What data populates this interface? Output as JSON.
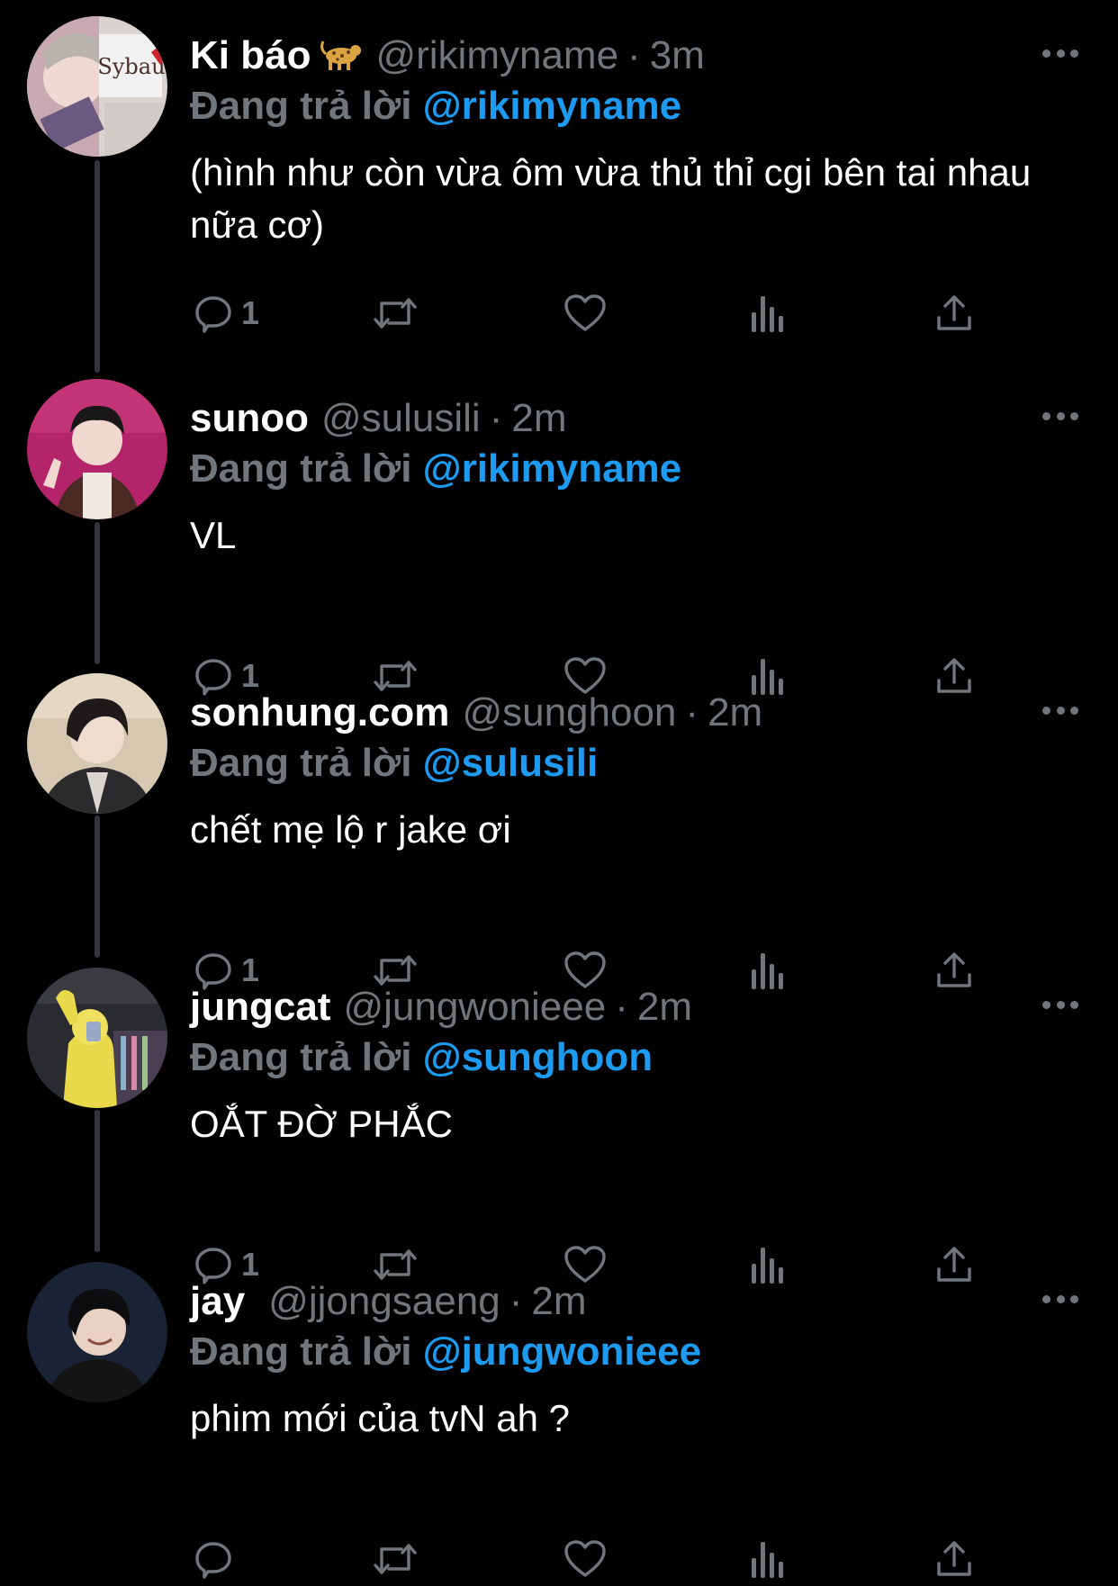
{
  "replying_prefix": "Đang trả lời",
  "colors": {
    "background": "#000000",
    "secondary_text": "#71767b",
    "mention": "#1d9bf0",
    "primary_text": "#ffffff"
  },
  "action_icons": [
    "reply-icon",
    "retweet-icon",
    "like-icon",
    "views-icon",
    "share-icon"
  ],
  "tweets": [
    {
      "name": "Ki báo",
      "name_emoji": "🐆",
      "handle": "@rikimyname",
      "dot": "·",
      "time": "3m",
      "reply_to": "@rikimyname",
      "text": "(hình như còn vừa ôm vừa thủ thỉ cgi bên tai nhau nữa cơ)",
      "reply_count": "1",
      "avatar_text": "Sybau"
    },
    {
      "name": "sunoo",
      "handle": "@sulusili",
      "dot": "·",
      "time": "2m",
      "reply_to": "@rikimyname",
      "text": "VL",
      "reply_count": "1"
    },
    {
      "name": "sonhung.com",
      "handle": "@sunghoon",
      "dot": "·",
      "time": "2m",
      "reply_to": "@sulusili",
      "text": "chết mẹ lộ r jake ơi",
      "reply_count": "1"
    },
    {
      "name": "jungcat",
      "handle": "@jungwonieee",
      "dot": "·",
      "time": "2m",
      "reply_to": "@sunghoon",
      "text": "OẮT ĐỜ PHẮC",
      "reply_count": "1"
    },
    {
      "name": "jay",
      "handle": "@jjongsaeng",
      "dot": "·",
      "time": "2m",
      "reply_to": "@jungwonieee",
      "text": "phim mới của tvN ah ?",
      "reply_count": ""
    }
  ]
}
